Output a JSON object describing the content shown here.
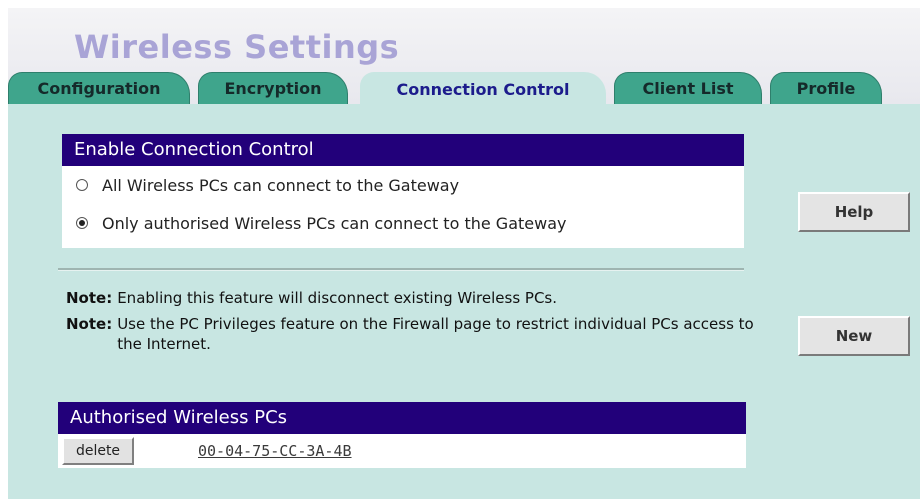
{
  "page": {
    "title": "Wireless Settings"
  },
  "tabs": [
    {
      "label": "Configuration",
      "active": false
    },
    {
      "label": "Encryption",
      "active": false
    },
    {
      "label": "Connection Control",
      "active": true
    },
    {
      "label": "Client List",
      "active": false
    },
    {
      "label": "Profile",
      "active": false
    }
  ],
  "connection_control": {
    "header": "Enable Connection Control",
    "options": [
      {
        "label": "All Wireless PCs can connect to the Gateway",
        "selected": false
      },
      {
        "label": "Only authorised Wireless PCs can connect to the Gateway",
        "selected": true
      }
    ]
  },
  "notes": [
    {
      "label": "Note:",
      "text": "Enabling this feature will disconnect existing Wireless PCs."
    },
    {
      "label": "Note:",
      "text": "Use the PC Privileges feature on the Firewall page to restrict individual PCs access to the Internet."
    }
  ],
  "buttons": {
    "help": "Help",
    "new": "New"
  },
  "authorised": {
    "header": "Authorised Wireless PCs",
    "rows": [
      {
        "delete_label": "delete",
        "mac": "00-04-75-CC-3A-4B"
      }
    ]
  },
  "colors": {
    "header_bar": "#22007a",
    "content_bg": "#c8e6e2",
    "tab_inactive": "#3fa58c",
    "title_text": "#a9a4d6"
  }
}
